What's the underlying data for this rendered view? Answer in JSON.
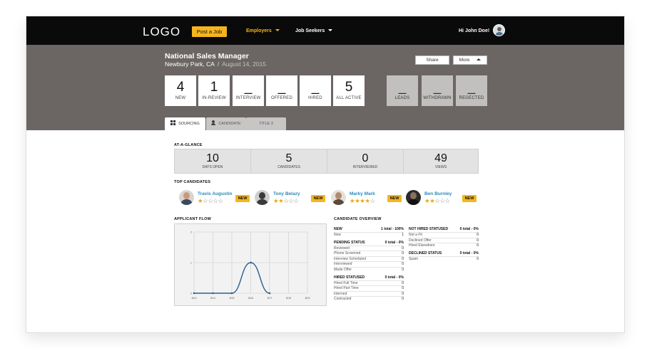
{
  "nav": {
    "logo": "LOGO",
    "post_job": "Post a Job",
    "employers": "Employers",
    "job_seekers": "Job Seekers",
    "greeting": "Hi John Doe!"
  },
  "job": {
    "title": "National Sales Manager",
    "location": "Newbury Park, CA",
    "separator": "/",
    "date": "August 14, 2015",
    "share": "Share",
    "more": "More"
  },
  "stats": [
    {
      "value": "4",
      "label": "NEW"
    },
    {
      "value": "1",
      "label": "IN-REVIEW"
    },
    {
      "value": "_",
      "label": "INTERVIEW"
    },
    {
      "value": "_",
      "label": "OFFERED"
    },
    {
      "value": "_",
      "label": "HIRED"
    },
    {
      "value": "5",
      "label": "ALL ACTIVE"
    }
  ],
  "stats_gray": [
    {
      "value": "_",
      "label": "LEADS"
    },
    {
      "value": "_",
      "label": "WITHDRAWN"
    },
    {
      "value": "_",
      "label": "REGECTED"
    }
  ],
  "tabs": {
    "sourcing": "SOURCING",
    "candidate": "CANDIDATE",
    "title3": "TITLE 3"
  },
  "glance": {
    "title": "AT-A-GLANCE",
    "cells": [
      {
        "value": "10",
        "label": "DAYS OPEN"
      },
      {
        "value": "5",
        "label": "CANDIDATES"
      },
      {
        "value": "0",
        "label": "INTERVIEWED"
      },
      {
        "value": "49",
        "label": "VIEWS"
      }
    ]
  },
  "top_candidates": {
    "title": "TOP CANDIDATES",
    "items": [
      {
        "name": "Travis Augustin",
        "rating": 1,
        "badge": "NEW"
      },
      {
        "name": "Tony Belazy",
        "rating": 2,
        "badge": "NEW"
      },
      {
        "name": "Marky Mark",
        "rating": 4,
        "badge": "NEW"
      },
      {
        "name": "Ben Burnley",
        "rating": 2,
        "badge": "NEW"
      }
    ]
  },
  "applicant_flow": {
    "title": "APPLICANT FLOW"
  },
  "chart_data": {
    "type": "line",
    "x": [
      "8/13",
      "8/14",
      "8/15",
      "8/16",
      "8/17",
      "8/18",
      "8/19"
    ],
    "y_ticks": [
      "0",
      "1",
      "2"
    ],
    "ylim": [
      0,
      2
    ],
    "series": [
      {
        "values": [
          0,
          0,
          0,
          1,
          0,
          null,
          null
        ]
      }
    ]
  },
  "overview": {
    "title": "CANDIDATE OVERVIEW",
    "left": [
      {
        "head": "NEW",
        "total": "1 total - 100%",
        "rows": [
          {
            "label": "New",
            "value": "1"
          }
        ]
      },
      {
        "head": "PENDING STATUS",
        "total": "0 total - 0%",
        "rows": [
          {
            "label": "Reviewed",
            "value": "0"
          },
          {
            "label": "Phone Screened",
            "value": "0"
          },
          {
            "label": "Interview Scheduled",
            "value": "0"
          },
          {
            "label": "Interviewed",
            "value": "0"
          },
          {
            "label": "Made Offer",
            "value": "0"
          }
        ]
      },
      {
        "head": "HIRED STATUSED",
        "total": "0 total - 0%",
        "rows": [
          {
            "label": "Hired Full Time",
            "value": "0"
          },
          {
            "label": "Hired Part Time",
            "value": "0"
          },
          {
            "label": "Interned",
            "value": "0"
          },
          {
            "label": "Contracted",
            "value": "0"
          }
        ]
      }
    ],
    "right": [
      {
        "head": "NOT HIRED STATUSED",
        "total": "0 total - 0%",
        "rows": [
          {
            "label": "Not a Fit",
            "value": "0"
          },
          {
            "label": "Declined Offer",
            "value": "0"
          },
          {
            "label": "Hired Elsewhere",
            "value": "0"
          }
        ]
      },
      {
        "head": "DECLINED STATUS",
        "total": "0 total - 0%",
        "rows": [
          {
            "label": "Spam",
            "value": "0"
          }
        ]
      }
    ]
  },
  "colors": {
    "accent": "#f4b51d",
    "band": "#6b6664",
    "link": "#2a8ab8",
    "line": "#2a5f8f"
  }
}
